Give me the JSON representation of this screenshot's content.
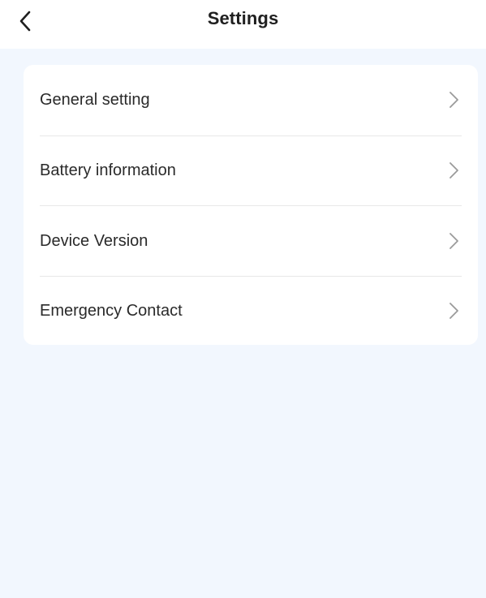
{
  "header": {
    "back_icon": "chevron-left-icon",
    "title": "Settings"
  },
  "settings": {
    "items": [
      {
        "label": "General setting",
        "icon": "chevron-right-icon"
      },
      {
        "label": "Battery information",
        "icon": "chevron-right-icon"
      },
      {
        "label": "Device Version",
        "icon": "chevron-right-icon"
      },
      {
        "label": "Emergency Contact",
        "icon": "chevron-right-icon"
      }
    ]
  },
  "colors": {
    "background": "#f2f7fe",
    "card": "#ffffff",
    "title_text": "#1f1f1f",
    "row_text": "#2a2a2a",
    "chevron": "#9a9a9a",
    "divider": "#e8e8e8"
  }
}
